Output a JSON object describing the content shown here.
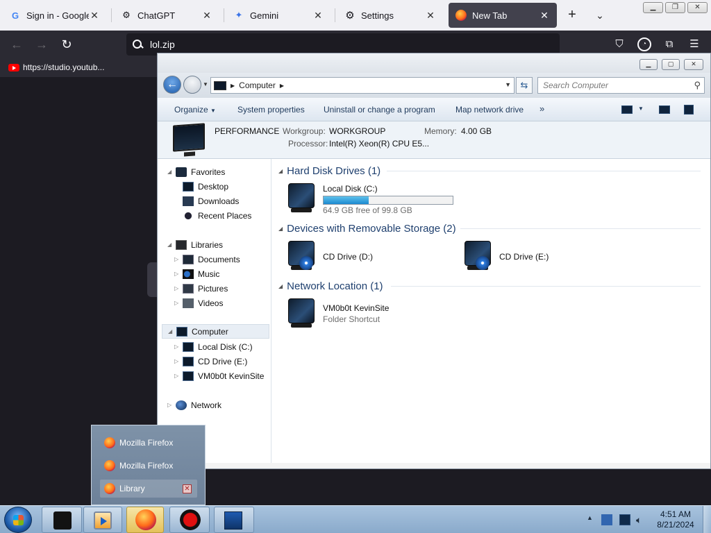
{
  "browser": {
    "tabs": [
      {
        "title": "Sign in - Google Accounts",
        "icon": "google-icon"
      },
      {
        "title": "ChatGPT",
        "icon": "chatgpt-icon"
      },
      {
        "title": "Gemini",
        "icon": "gemini-icon"
      },
      {
        "title": "Settings",
        "icon": "gear-icon"
      },
      {
        "title": "New Tab",
        "icon": "firefox-icon",
        "active": true
      }
    ],
    "url": "lol.zip",
    "bookmark": "https://studio.youtub..."
  },
  "explorer": {
    "address": "Computer",
    "search_placeholder": "Search Computer",
    "commands": {
      "organize": "Organize",
      "system_properties": "System properties",
      "uninstall": "Uninstall or change a program",
      "map_drive": "Map network drive",
      "more": "»"
    },
    "details": {
      "name": "PERFORMANCE",
      "workgroup_label": "Workgroup:",
      "workgroup": "WORKGROUP",
      "memory_label": "Memory:",
      "memory": "4.00 GB",
      "processor_label": "Processor:",
      "processor": "Intel(R) Xeon(R) CPU E5..."
    },
    "nav": {
      "favorites": "Favorites",
      "desktop": "Desktop",
      "downloads": "Downloads",
      "recent": "Recent Places",
      "libraries": "Libraries",
      "documents": "Documents",
      "music": "Music",
      "pictures": "Pictures",
      "videos": "Videos",
      "computer": "Computer",
      "local_disk": "Local Disk (C:)",
      "cd_drive": "CD Drive (E:)",
      "kevinsite": "VM0b0t KevinSite",
      "network": "Network"
    },
    "groups": {
      "hdd": "Hard Disk Drives (1)",
      "removable": "Devices with Removable Storage (2)",
      "network": "Network Location (1)"
    },
    "items": {
      "local_disk_name": "Local Disk (C:)",
      "local_disk_free": "64.9 GB free of 99.8 GB",
      "local_disk_used_fraction": 0.35,
      "cd_d": "CD Drive (D:)",
      "cd_e": "CD Drive (E:)",
      "net_name": "VM0b0t KevinSite",
      "net_type": "Folder Shortcut"
    }
  },
  "jumplist": {
    "items": [
      "Mozilla Firefox",
      "Mozilla Firefox",
      "Library"
    ]
  },
  "taskbar": {
    "time": "4:51 AM",
    "date": "8/21/2024"
  }
}
